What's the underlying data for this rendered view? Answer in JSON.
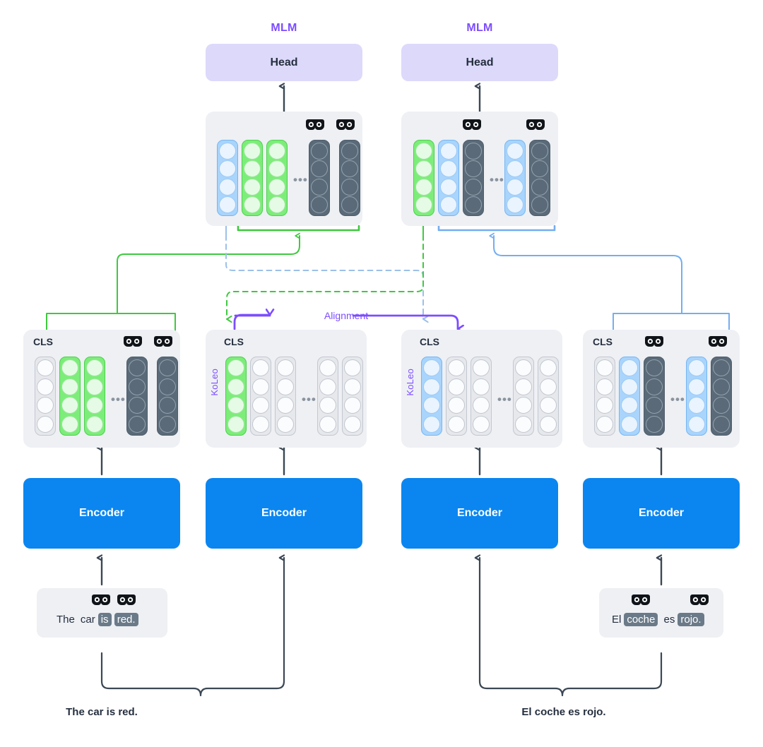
{
  "theme": {
    "accent_purple": "#7c4dff",
    "encoder_blue": "#0b86f0",
    "head_lavender": "#ddd9fb",
    "panel_grey": "#eef0f4",
    "green": "#4ad24a",
    "blue": "#74b6f5",
    "dark": "#5a6a78",
    "text_dark": "#252f3f"
  },
  "heads": [
    {
      "label": "MLM",
      "box": "Head"
    },
    {
      "label": "MLM",
      "box": "Head"
    }
  ],
  "encoders": [
    {
      "label": "Encoder"
    },
    {
      "label": "Encoder"
    },
    {
      "label": "Encoder"
    },
    {
      "label": "Encoder"
    }
  ],
  "top_panels": [
    {
      "name": "mlm-embeddings-english",
      "cls_label": "",
      "koleo_label": "",
      "dots": "•••",
      "masks": 2,
      "columns": [
        "blue",
        "green",
        "green",
        "dark",
        "dark"
      ]
    },
    {
      "name": "mlm-embeddings-spanish",
      "cls_label": "",
      "koleo_label": "",
      "dots": "•••",
      "masks": 2,
      "columns": [
        "green",
        "blue",
        "dark",
        "blue",
        "dark"
      ]
    }
  ],
  "bottom_panels": [
    {
      "name": "encoder-output-english-masked",
      "cls_label": "CLS",
      "koleo_label": "",
      "dots": "•••",
      "masks": 2,
      "columns": [
        "grey",
        "green",
        "green",
        "dark",
        "dark"
      ]
    },
    {
      "name": "encoder-output-english-clean",
      "cls_label": "CLS",
      "koleo_label": "KoLeo",
      "dots": "•••",
      "masks": 0,
      "columns": [
        "green",
        "grey",
        "grey",
        "grey",
        "grey"
      ]
    },
    {
      "name": "encoder-output-spanish-clean",
      "cls_label": "CLS",
      "koleo_label": "KoLeo",
      "dots": "•••",
      "masks": 0,
      "columns": [
        "blue",
        "grey",
        "grey",
        "grey",
        "grey"
      ]
    },
    {
      "name": "encoder-output-spanish-masked",
      "cls_label": "CLS",
      "koleo_label": "",
      "dots": "•••",
      "masks": 2,
      "columns": [
        "grey",
        "blue",
        "dark",
        "blue",
        "dark"
      ]
    }
  ],
  "inputs": [
    {
      "name": "masked-sentence-english",
      "tokens": [
        {
          "text": "The",
          "masked": false
        },
        {
          "text": "car",
          "masked": false
        },
        {
          "text": "is",
          "masked": true
        },
        {
          "text": "red.",
          "masked": true
        }
      ]
    },
    {
      "name": "masked-sentence-spanish",
      "tokens": [
        {
          "text": "El",
          "masked": false
        },
        {
          "text": "coche",
          "masked": true
        },
        {
          "text": "es",
          "masked": false
        },
        {
          "text": "rojo.",
          "masked": true
        }
      ]
    }
  ],
  "captions": [
    {
      "text": "The car is red."
    },
    {
      "text": "El coche es rojo."
    }
  ],
  "alignment": {
    "label": "Alignment"
  },
  "icons": {
    "mask": "mask-icon",
    "arrow_up": "arrow-up-icon"
  }
}
